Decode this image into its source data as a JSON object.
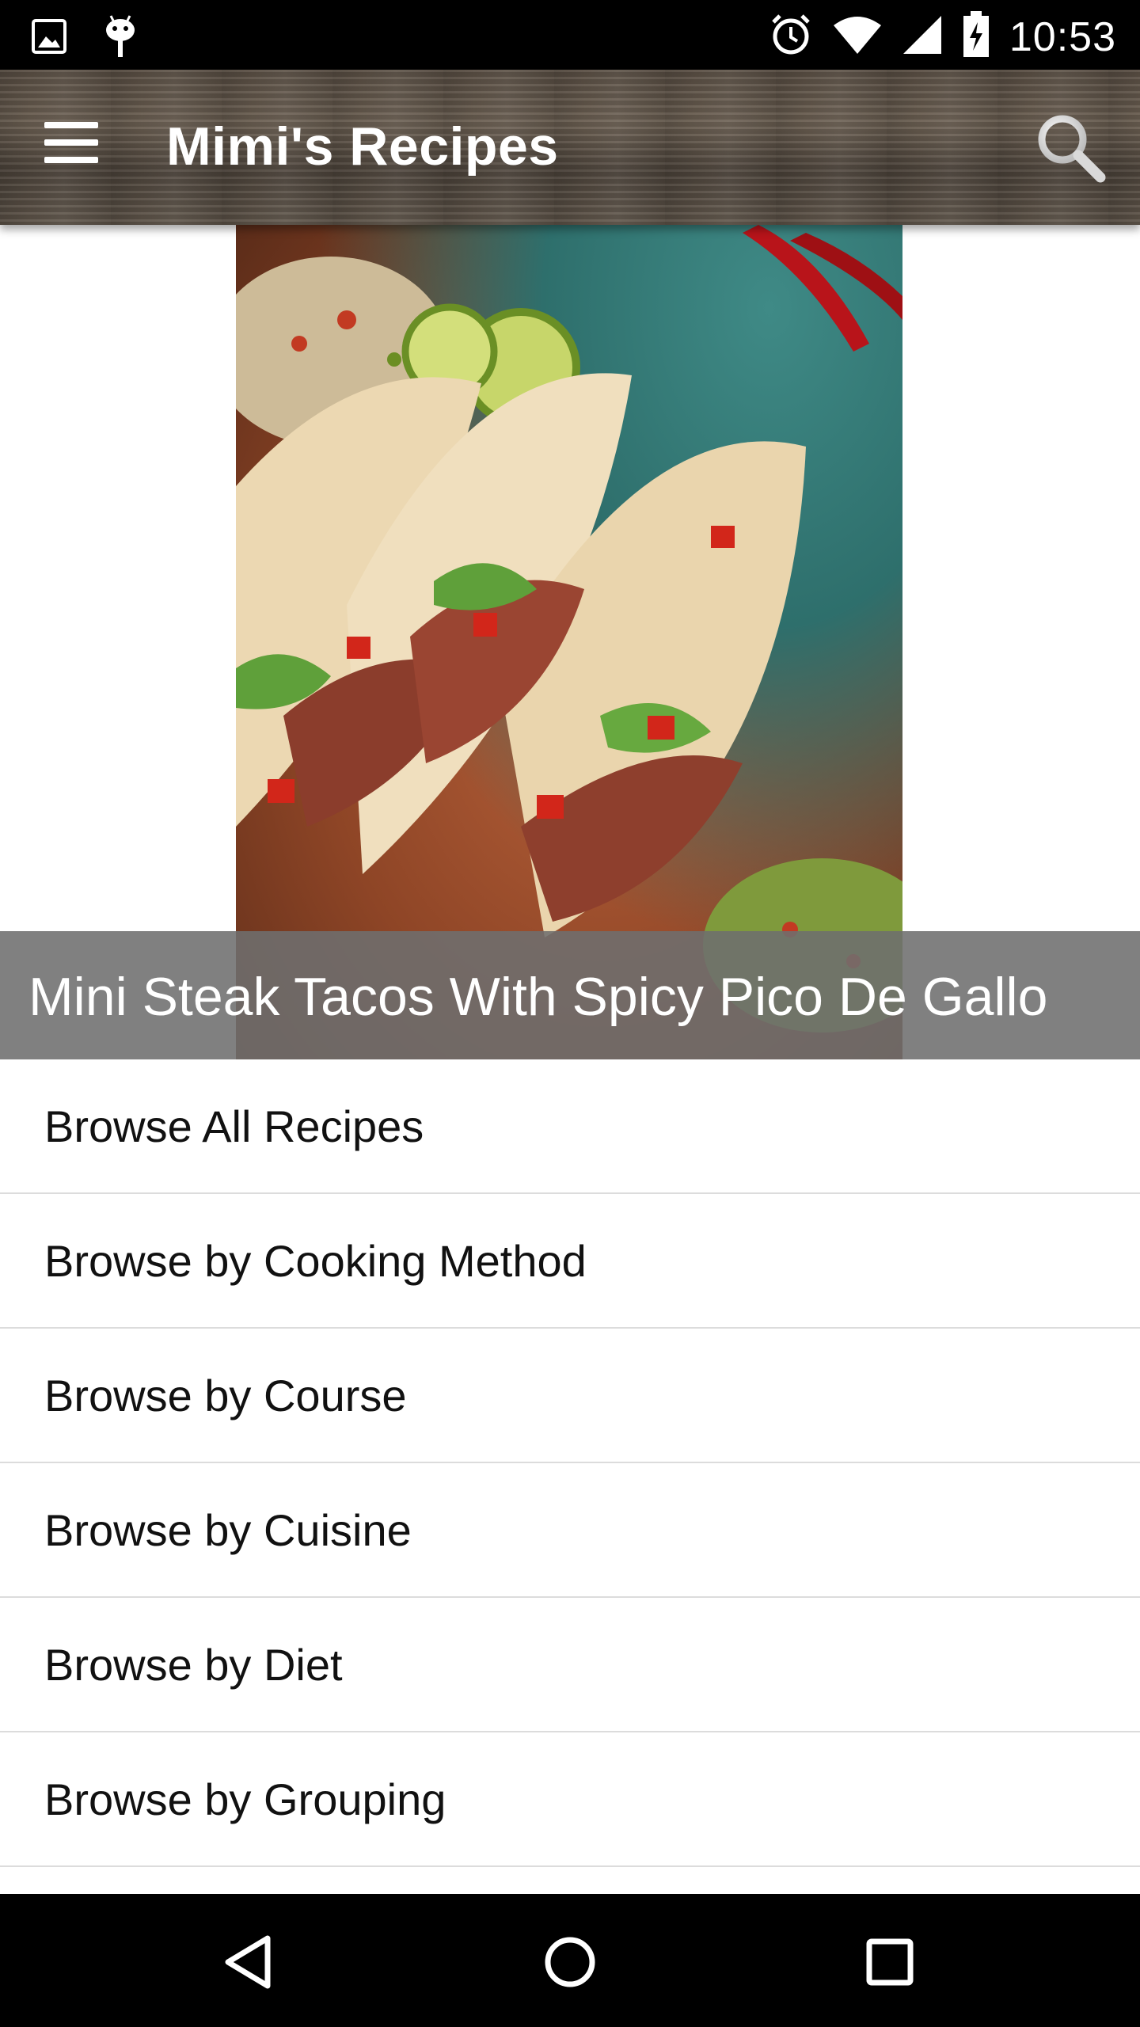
{
  "status_bar": {
    "time": "10:53",
    "left_icons": [
      "image-icon",
      "android-icon"
    ],
    "right_icons": [
      "alarm-icon",
      "wifi-icon",
      "signal-icon",
      "battery-charging-icon"
    ]
  },
  "toolbar": {
    "title": "Mimi's Recipes",
    "menu_icon": "hamburger-menu-icon",
    "search_icon": "search-icon",
    "background": "wood-texture"
  },
  "featured": {
    "caption": "Mini Steak Tacos With Spicy Pico De Gallo"
  },
  "menu": {
    "items": [
      {
        "label": "Browse All Recipes"
      },
      {
        "label": "Browse by Cooking Method"
      },
      {
        "label": "Browse by Course"
      },
      {
        "label": "Browse by Cuisine"
      },
      {
        "label": "Browse by Diet"
      },
      {
        "label": "Browse by Grouping"
      }
    ]
  },
  "nav_bar": {
    "buttons": [
      "back-icon",
      "home-icon",
      "recents-icon"
    ]
  },
  "colors": {
    "status_bar": "#000000",
    "caption_overlay": "#6e6e6e",
    "divider": "#dcdcdc",
    "text": "#111111"
  }
}
